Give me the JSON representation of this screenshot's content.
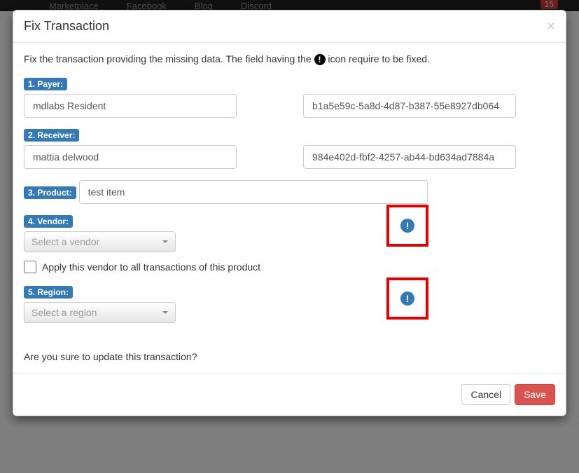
{
  "bgnav": {
    "marketplace": "Marketplace",
    "facebook": "Facebook",
    "blog": "Blog",
    "discord": "Discord",
    "notif_count": "15"
  },
  "modal": {
    "title": "Fix Transaction",
    "intro_pre": "Fix the transaction providing the missing data. The field having the ",
    "intro_post": " icon require to be fixed.",
    "confirm": "Are you sure to update this transaction?",
    "cancel": "Cancel",
    "save": "Save"
  },
  "fields": {
    "payer": {
      "label": "1. Payer:",
      "value": "mdlabs Resident",
      "id_value": "b1a5e59c-5a8d-4d87-b387-55e8927db064"
    },
    "receiver": {
      "label": "2. Receiver:",
      "value": "mattia delwood",
      "id_value": "984e402d-fbf2-4257-ab44-bd634ad7884a"
    },
    "product": {
      "label": "3. Product:",
      "value": "test item"
    },
    "vendor": {
      "label": "4. Vendor:",
      "placeholder": "Select a vendor",
      "apply_all": "Apply this vendor to all transactions of this product"
    },
    "region": {
      "label": "5. Region:",
      "placeholder": "Select a region"
    }
  }
}
